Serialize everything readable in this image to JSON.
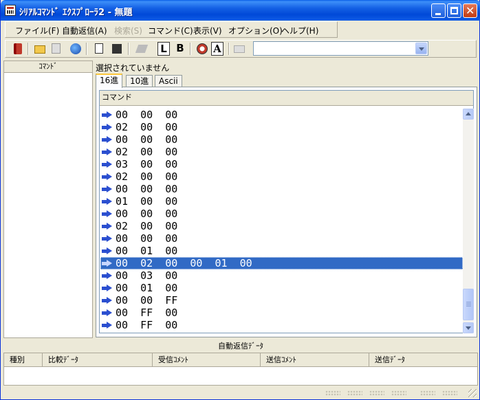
{
  "window": {
    "title": "ｼﾘｱﾙｺﾏﾝﾄﾞ ｴｸｽﾌﾟﾛｰﾗ2 - 無題"
  },
  "menu": [
    {
      "label": "ファイル(F)",
      "disabled": false
    },
    {
      "label": "自動返信(A)",
      "disabled": false
    },
    {
      "label": "検索(S)",
      "disabled": true
    },
    {
      "label": "コマンド(C)",
      "disabled": false
    },
    {
      "label": "表示(V)",
      "disabled": false
    },
    {
      "label": "オプション(O)",
      "disabled": false
    },
    {
      "label": "ヘルプ(H)",
      "disabled": false
    }
  ],
  "toolbar": {
    "icons": [
      "book-icon",
      "open-folder-icon",
      "copy-icon",
      "globe-icon",
      "document-icon",
      "save-icon",
      "edit-icon",
      "letter-l-icon",
      "letter-b-icon",
      "record-icon",
      "letter-a-icon",
      "envelope-icon"
    ],
    "letter_l": "L",
    "letter_b": "B",
    "letter_a": "A",
    "combo_value": ""
  },
  "left_pane": {
    "header": "ｺﾏﾝﾄﾞ"
  },
  "right_pane": {
    "selection_label": "選択されていません",
    "tabs": [
      "16進",
      "10進",
      "Ascii"
    ],
    "active_tab": 0,
    "list_header": "コマンド",
    "rows": [
      "00  00  00",
      "02  00  00",
      "00  00  00",
      "02  00  00",
      "03  00  00",
      "02  00  00",
      "00  00  00",
      "01  00  00",
      "00  00  00",
      "02  00  00",
      "00  00  00",
      "00  01  00",
      "00  02  00  00  01  00",
      "00  03  00",
      "00  01  00",
      "00  00  FF",
      "00  FF  00",
      "00  FF  00"
    ],
    "selected_row": 12
  },
  "auto_reply": {
    "title": "自動返信ﾃﾞｰﾀ",
    "columns": [
      "種別",
      "比較ﾃﾞｰﾀ",
      "受信ｺﾒﾝﾄ",
      "送信ｺﾒﾝﾄ",
      "送信ﾃﾞｰﾀ"
    ]
  },
  "colors": {
    "titlebar": "#0a5fe8",
    "selection": "#316ac5",
    "arrow": "#2b4fd0",
    "window_bg": "#ece9d8"
  }
}
